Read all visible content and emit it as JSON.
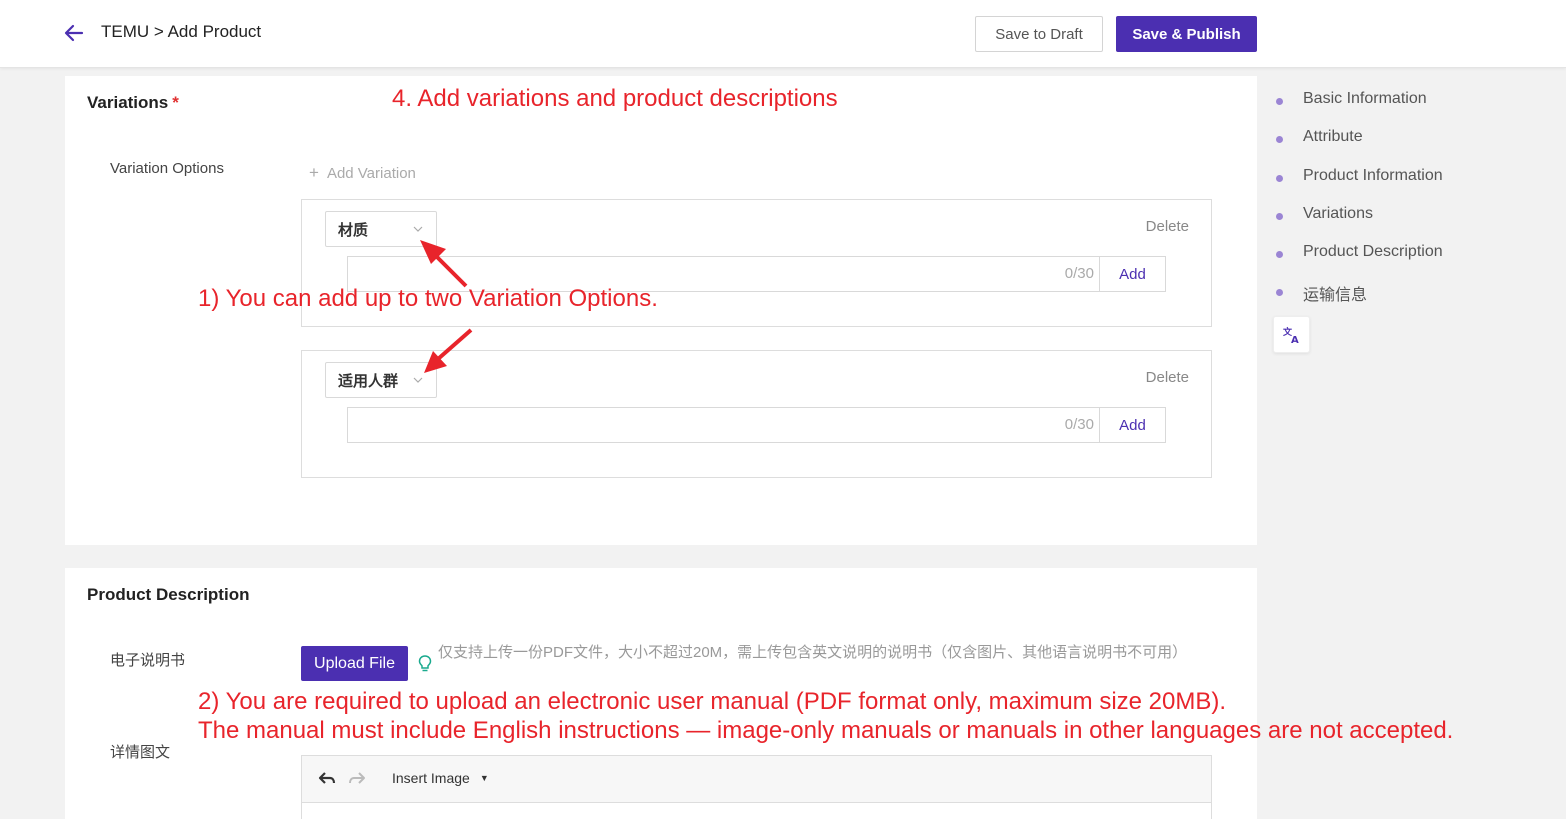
{
  "header": {
    "title": "TEMU > Add Product",
    "save_draft_label": "Save to Draft",
    "publish_label": "Save & Publish"
  },
  "variations": {
    "title": "Variations",
    "required_mark": "*",
    "options_label": "Variation Options",
    "add_variation_label": "Add Variation",
    "boxes": [
      {
        "name": "材质",
        "delete_label": "Delete",
        "input_value": "",
        "char_count": "0/30",
        "add_label": "Add"
      },
      {
        "name": "适用人群",
        "delete_label": "Delete",
        "input_value": "",
        "char_count": "0/30",
        "add_label": "Add"
      }
    ]
  },
  "description": {
    "title": "Product Description",
    "manual_label": "电子说明书",
    "upload_label": "Upload File",
    "upload_hint": "仅支持上传一份PDF文件，大小不超过20M，需上传包含英文说明的说明书（仅含图片、其他语言说明书不可用）",
    "detail_label": "详情图文",
    "editor": {
      "insert_image_label": "Insert Image"
    }
  },
  "nav": {
    "items": [
      {
        "label": "Basic Information"
      },
      {
        "label": "Attribute"
      },
      {
        "label": "Product Information"
      },
      {
        "label": "Variations"
      },
      {
        "label": "Product Description"
      },
      {
        "label": "运输信息"
      }
    ]
  },
  "annotations": {
    "step4": "4. Add variations and product descriptions",
    "note1": "1) You can add up to two Variation Options.",
    "note2_line1": "2) You are required to upload an electronic user manual (PDF format only, maximum size 20MB).",
    "note2_line2": "The manual must include English instructions — image-only manuals or manuals in other languages are not accepted."
  },
  "colors": {
    "brand": "#4b2fb1",
    "annotation": "#e8242b",
    "nav_dot": "#9b85d4",
    "hint_icon": "#1aaa8e"
  },
  "icons": {
    "back": "arrow-left-icon",
    "chevron": "chevron-down-icon",
    "bulb": "lightbulb-icon",
    "undo": "undo-icon",
    "redo": "redo-icon",
    "translate": "translate-icon"
  }
}
